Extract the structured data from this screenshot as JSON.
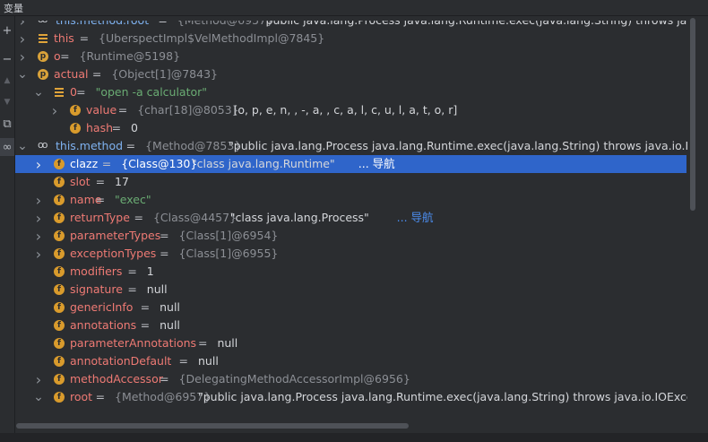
{
  "panel": {
    "title": "变量"
  },
  "toolbar": {
    "add_label": "+",
    "remove_label": "−",
    "up_label": "▲",
    "down_label": "▼",
    "copy_label": "⧉",
    "watch_label": "∞"
  },
  "rows": [
    {
      "indent": 0,
      "arrow": "right",
      "icon": "watch",
      "name": "this.method.root",
      "eq": " = ",
      "ref": "{Method@6957}",
      "value": " \"public java.lang.Process java.lang.Runtime.exec(java.lang.String) throws java.i",
      "value_kind": "val"
    },
    {
      "indent": 0,
      "arrow": "right",
      "icon": "stack",
      "name": "this",
      "eq": " = ",
      "ref": "{UberspectImpl$VelMethodImpl@7845}",
      "value": "",
      "value_kind": "val"
    },
    {
      "indent": 0,
      "arrow": "right",
      "icon": "param",
      "name": "o",
      "eq": " = ",
      "ref": "{Runtime@5198}",
      "value": "",
      "value_kind": "val"
    },
    {
      "indent": 0,
      "arrow": "down",
      "icon": "param",
      "name": "actual",
      "eq": " = ",
      "ref": "{Object[1]@7843}",
      "value": "",
      "value_kind": "val"
    },
    {
      "indent": 1,
      "arrow": "down",
      "icon": "stack",
      "name": "0",
      "eq": " = ",
      "ref": "",
      "value": "\"open -a calculator\"",
      "value_kind": "str"
    },
    {
      "indent": 2,
      "arrow": "right",
      "icon": "field",
      "name": "value",
      "eq": " = ",
      "ref": "{char[18]@8053}",
      "value": " [o, p, e, n,  , -, a,  , c, a, l, c, u, l, a, t, o, r]",
      "value_kind": "val"
    },
    {
      "indent": 2,
      "arrow": "none",
      "icon": "field",
      "name": "hash",
      "eq": " = ",
      "ref": "",
      "value": "0",
      "value_kind": "val"
    },
    {
      "indent": 0,
      "arrow": "down",
      "icon": "watch",
      "name": "this.method",
      "eq": " = ",
      "ref": "{Method@7853}",
      "value": " \"public java.lang.Process java.lang.Runtime.exec(java.lang.String) throws java.io.IOEx",
      "value_kind": "val"
    },
    {
      "indent": 1,
      "arrow": "right",
      "icon": "field",
      "name": "clazz",
      "eq": " = ",
      "ref": "{Class@130}",
      "value": " \"class java.lang.Runtime\"",
      "value_kind": "val",
      "link": " ... 导航",
      "selected": true
    },
    {
      "indent": 1,
      "arrow": "none",
      "icon": "field",
      "name": "slot",
      "eq": " = ",
      "ref": "",
      "value": "17",
      "value_kind": "val"
    },
    {
      "indent": 1,
      "arrow": "right",
      "icon": "field",
      "name": "name",
      "eq": " = ",
      "ref": "",
      "value": "\"exec\"",
      "value_kind": "str"
    },
    {
      "indent": 1,
      "arrow": "right",
      "icon": "field",
      "name": "returnType",
      "eq": " = ",
      "ref": "{Class@4457}",
      "value": " \"class java.lang.Process\"",
      "value_kind": "val",
      "link": " ... 导航"
    },
    {
      "indent": 1,
      "arrow": "right",
      "icon": "field",
      "name": "parameterTypes",
      "eq": " = ",
      "ref": "{Class[1]@6954}",
      "value": "",
      "value_kind": "val"
    },
    {
      "indent": 1,
      "arrow": "right",
      "icon": "field",
      "name": "exceptionTypes",
      "eq": " = ",
      "ref": "{Class[1]@6955}",
      "value": "",
      "value_kind": "val"
    },
    {
      "indent": 1,
      "arrow": "none",
      "icon": "field",
      "name": "modifiers",
      "eq": " = ",
      "ref": "",
      "value": "1",
      "value_kind": "val"
    },
    {
      "indent": 1,
      "arrow": "none",
      "icon": "field",
      "name": "signature",
      "eq": " = ",
      "ref": "",
      "value": "null",
      "value_kind": "val"
    },
    {
      "indent": 1,
      "arrow": "none",
      "icon": "field",
      "name": "genericInfo",
      "eq": " = ",
      "ref": "",
      "value": "null",
      "value_kind": "val"
    },
    {
      "indent": 1,
      "arrow": "none",
      "icon": "field",
      "name": "annotations",
      "eq": " = ",
      "ref": "",
      "value": "null",
      "value_kind": "val"
    },
    {
      "indent": 1,
      "arrow": "none",
      "icon": "field",
      "name": "parameterAnnotations",
      "eq": " = ",
      "ref": "",
      "value": "null",
      "value_kind": "val"
    },
    {
      "indent": 1,
      "arrow": "none",
      "icon": "field",
      "name": "annotationDefault",
      "eq": " = ",
      "ref": "",
      "value": "null",
      "value_kind": "val"
    },
    {
      "indent": 1,
      "arrow": "right",
      "icon": "field",
      "name": "methodAccessor",
      "eq": " = ",
      "ref": "{DelegatingMethodAccessorImpl@6956}",
      "value": "",
      "value_kind": "val"
    },
    {
      "indent": 1,
      "arrow": "down",
      "icon": "field",
      "name": "root",
      "eq": " = ",
      "ref": "{Method@6957}",
      "value": " \"public java.lang.Process java.lang.Runtime.exec(java.lang.String) throws java.io.IOExcep",
      "value_kind": "val"
    }
  ]
}
